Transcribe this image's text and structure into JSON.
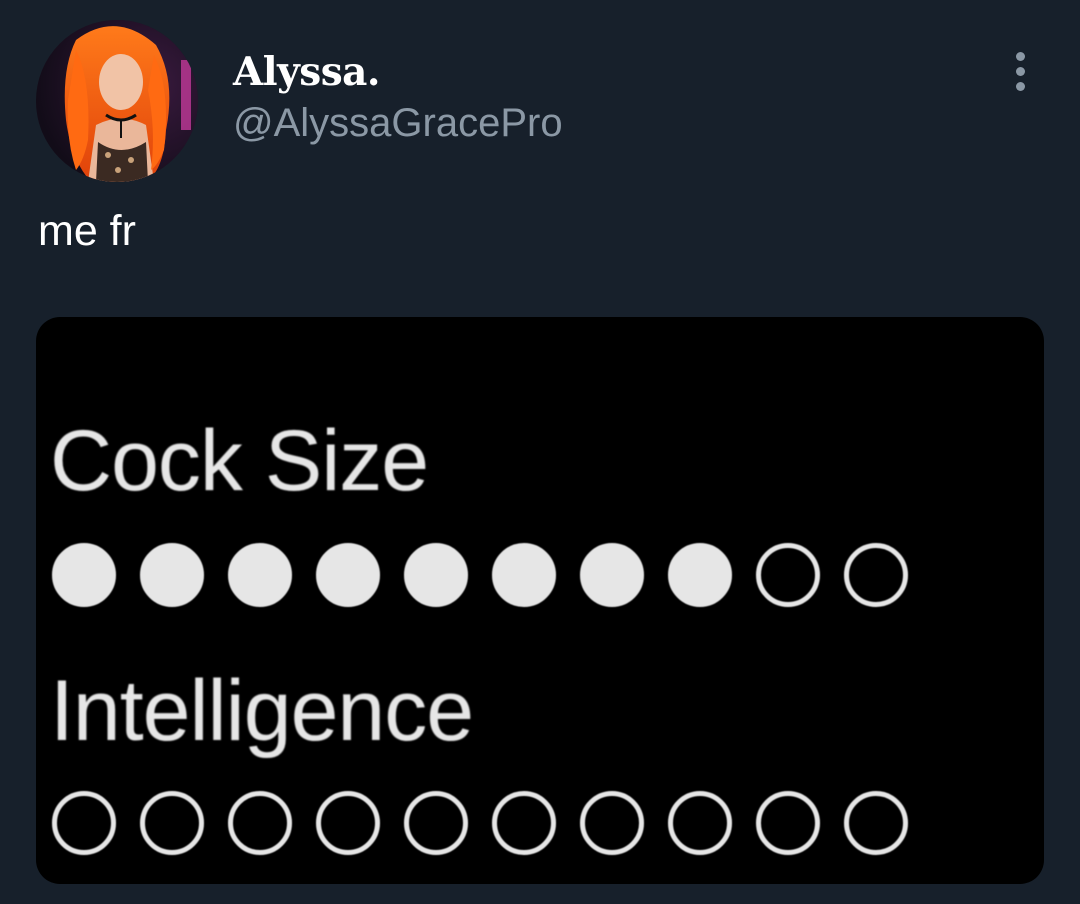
{
  "tweet": {
    "author_name": "Alyssa.",
    "author_handle": "@AlyssaGracePro",
    "text": "me fr",
    "avatar_icon": "profile-photo",
    "more_icon": "more-options-icon"
  },
  "media": {
    "meme": {
      "rows": [
        {
          "label": "Cock Size",
          "filled": 8,
          "total": 10
        },
        {
          "label": "Intelligence",
          "filled": 0,
          "total": 10
        }
      ],
      "text_color": "#e6e6e6",
      "background": "#000000"
    }
  },
  "colors": {
    "background": "#17202b",
    "primary_text": "#ffffff",
    "secondary_text": "#8b98a5"
  }
}
